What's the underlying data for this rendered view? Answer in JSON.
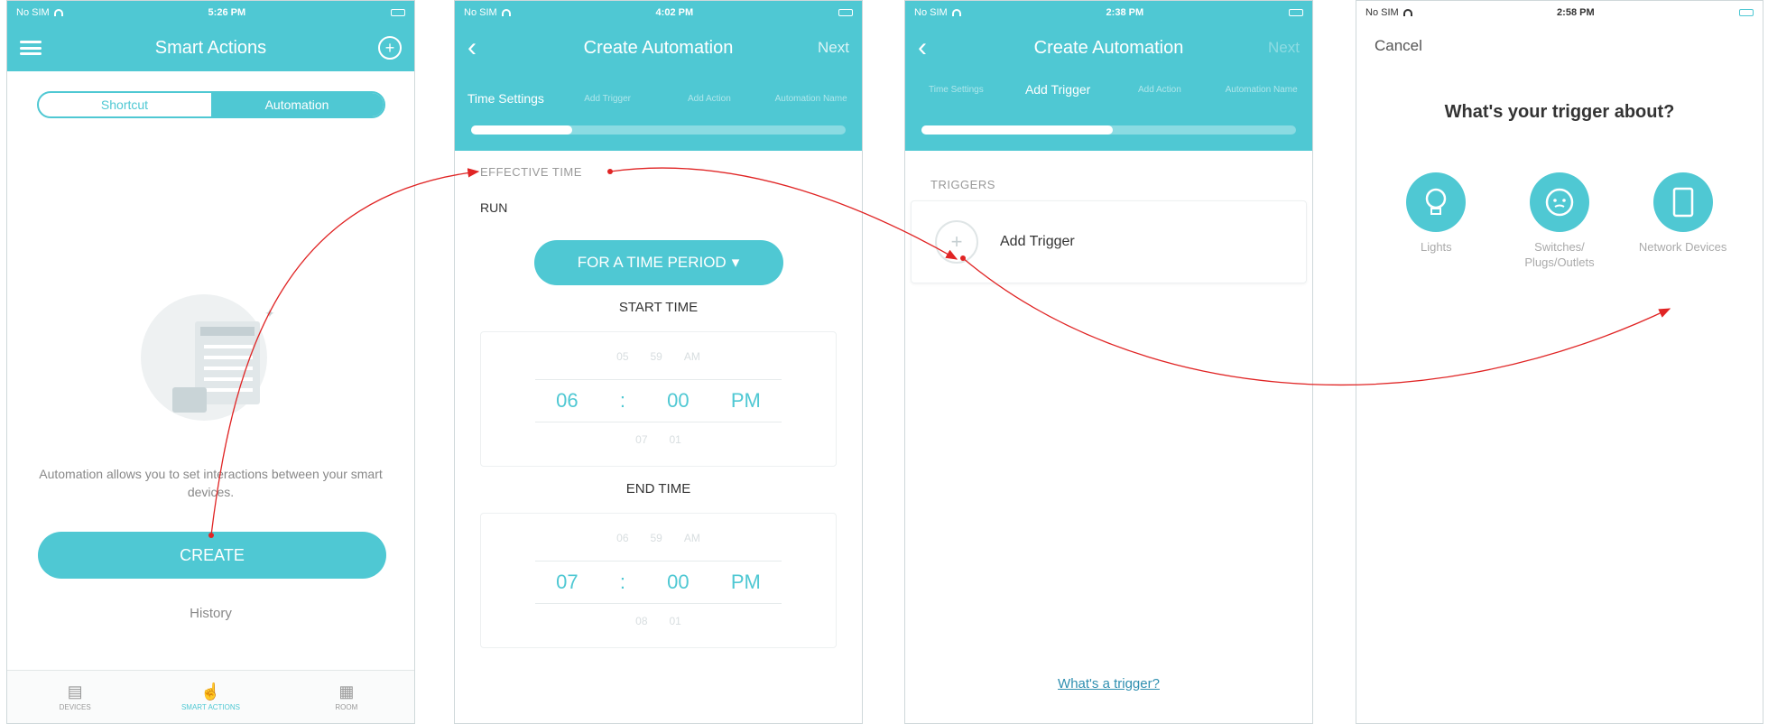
{
  "colors": {
    "accent": "#4fc8d3",
    "arrow": "#e02424",
    "link": "#2f8fb0"
  },
  "screen1": {
    "status": {
      "carrier": "No SIM",
      "time": "5:26 PM"
    },
    "nav_title": "Smart Actions",
    "menu_icon": "hamburger-icon",
    "add_icon": "add-circle-icon",
    "segments": [
      "Shortcut",
      "Automation"
    ],
    "active_segment": "Automation",
    "description": "Automation allows you to set interactions between your smart devices.",
    "create_label": "CREATE",
    "history_label": "History",
    "tabs": [
      {
        "label": "DEVICES",
        "icon": "devices-icon"
      },
      {
        "label": "SMART ACTIONS",
        "icon": "smart-actions-icon"
      },
      {
        "label": "ROOM",
        "icon": "room-icon"
      }
    ]
  },
  "screen2": {
    "status": {
      "carrier": "No SIM",
      "time": "4:02 PM"
    },
    "nav_title": "Create Automation",
    "next_label": "Next",
    "steps": [
      "Time Settings",
      "Add Trigger",
      "Add Action",
      "Automation Name"
    ],
    "active_step": "Time Settings",
    "progress": 0.27,
    "section_label": "EFFECTIVE TIME",
    "run_label": "RUN",
    "period_button": "FOR A TIME PERIOD",
    "start_label": "START TIME",
    "start_time": {
      "hour": "06",
      "minute": "00",
      "ampm": "PM",
      "hour_above": "05",
      "minute_above": "59",
      "hour_below": "07",
      "minute_below": "01",
      "ampm_above": "AM"
    },
    "end_label": "END TIME",
    "end_time": {
      "hour": "07",
      "minute": "00",
      "ampm": "PM",
      "hour_above": "06",
      "minute_above": "59",
      "hour_below": "08",
      "minute_below": "01",
      "ampm_above": "AM"
    }
  },
  "screen3": {
    "status": {
      "carrier": "No SIM",
      "time": "2:38 PM"
    },
    "nav_title": "Create Automation",
    "next_label": "Next",
    "steps": [
      "Time Settings",
      "Add Trigger",
      "Add Action",
      "Automation Name"
    ],
    "active_step": "Add Trigger",
    "progress": 0.51,
    "section_label": "TRIGGERS",
    "add_trigger_label": "Add Trigger",
    "help_link": "What's a trigger?"
  },
  "screen4": {
    "status": {
      "carrier": "No SIM",
      "time": "2:58 PM"
    },
    "cancel_label": "Cancel",
    "question": "What's your trigger about?",
    "categories": [
      {
        "label": "Lights",
        "icon": "bulb-icon"
      },
      {
        "label": "Switches/ Plugs/Outlets",
        "icon": "outlet-icon"
      },
      {
        "label": "Network Devices",
        "icon": "tablet-icon"
      }
    ]
  }
}
